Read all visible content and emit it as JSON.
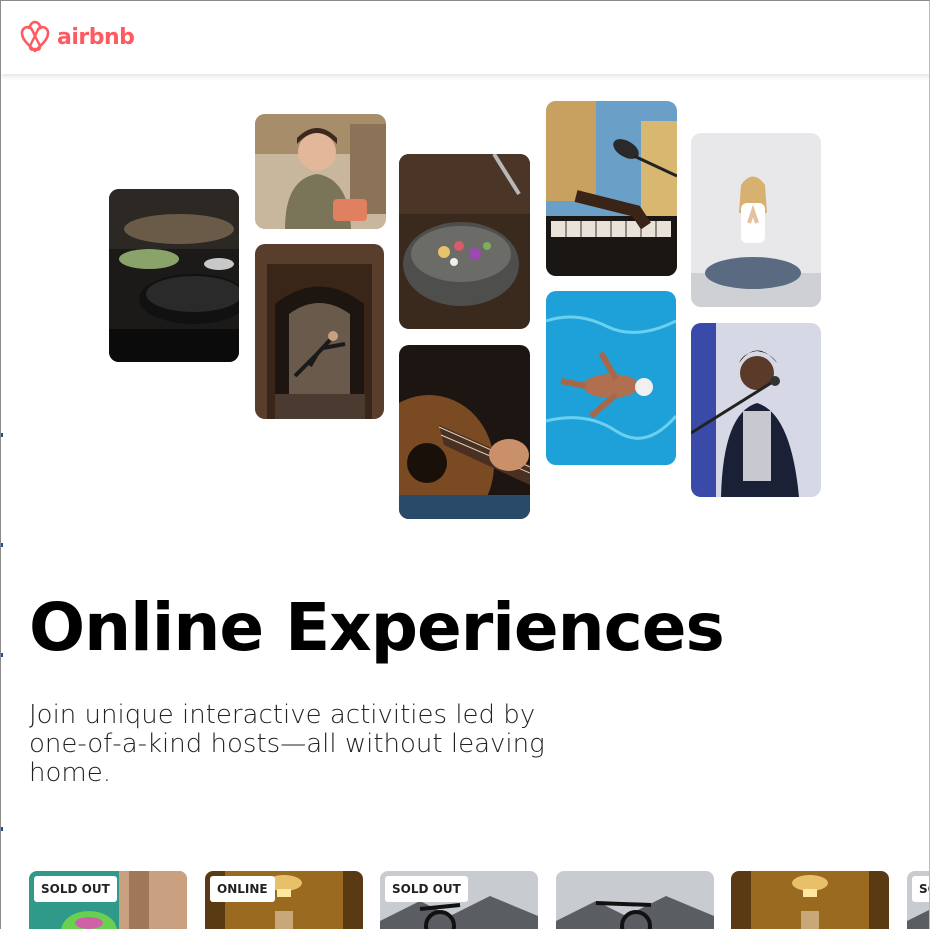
{
  "brand": {
    "name": "airbnb",
    "color": "#FF5A5F",
    "logo_icon": "airbnb-belo-icon"
  },
  "hero_photos": [
    {
      "id": "cooking-pan",
      "label": "cooking-photo"
    },
    {
      "id": "chef-woman",
      "label": "chef-photo"
    },
    {
      "id": "dancer",
      "label": "dancer-photo"
    },
    {
      "id": "food-bowl",
      "label": "food-bowl-photo"
    },
    {
      "id": "guitar",
      "label": "guitar-photo"
    },
    {
      "id": "keyboard-mic",
      "label": "keyboard-photo"
    },
    {
      "id": "swimmer",
      "label": "swimmer-photo"
    },
    {
      "id": "yoga",
      "label": "yoga-photo"
    },
    {
      "id": "singer",
      "label": "singer-photo"
    }
  ],
  "hero": {
    "title": "Online Experiences",
    "subtitle": "Join unique interactive activities led by one-of-a-kind hosts—all without leaving home."
  },
  "cards": [
    {
      "badge": "SOLD OUT",
      "image": "swimmer-cap"
    },
    {
      "badge": "ONLINE",
      "image": "lamp-interior"
    },
    {
      "badge": "SOLD OUT",
      "image": "mountain-bike"
    },
    {
      "badge": "",
      "image": "mountain-bike"
    },
    {
      "badge": "",
      "image": "lamp-interior"
    },
    {
      "badge": "SOLD OUT",
      "image": "mountain-bike"
    }
  ]
}
